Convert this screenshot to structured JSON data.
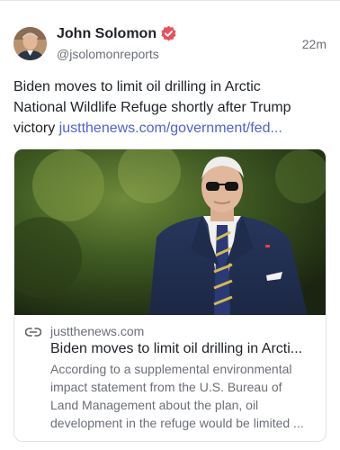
{
  "post": {
    "author": {
      "name": "John Solomon",
      "handle": "@jsolomonreports",
      "verified": true,
      "verified_color": "#e8505b"
    },
    "timestamp": "22m",
    "text_line1": "Biden moves to limit oil drilling in Arctic",
    "text_line2": "National Wildlife Refuge shortly after Trump",
    "text_line3_prefix": "victory ",
    "link_text": "justthenews.com/government/fed...",
    "link_color": "#4b63d9"
  },
  "card": {
    "domain": "justthenews.com",
    "title": "Biden moves to limit oil drilling in Arcti...",
    "description_lines": [
      "According to a supplemental environmental",
      "impact statement from the U.S. Bureau of",
      "Land Management about the plan, oil",
      "development in the refuge would be limited ..."
    ]
  }
}
